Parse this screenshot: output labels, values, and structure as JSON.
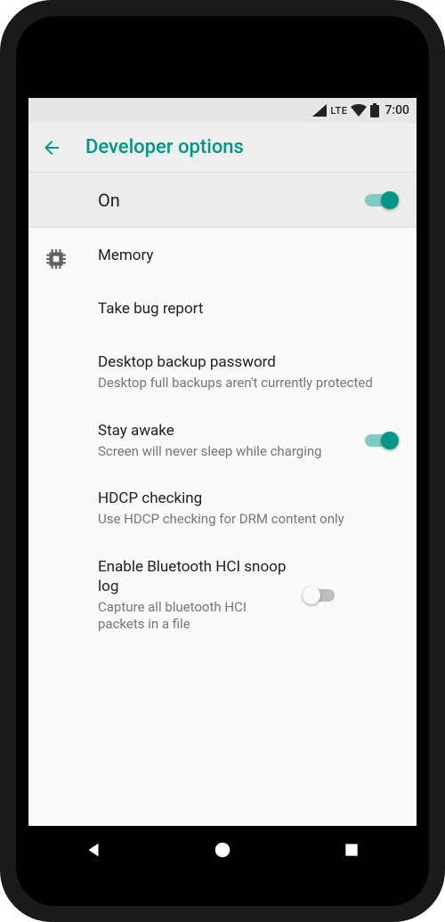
{
  "statusbar": {
    "network_label": "LTE",
    "time": "7:00"
  },
  "appbar": {
    "title": "Developer options"
  },
  "master": {
    "label": "On",
    "enabled": true
  },
  "items": [
    {
      "title": "Memory",
      "subtitle": null,
      "has_icon": true,
      "switch": null
    },
    {
      "title": "Take bug report",
      "subtitle": null,
      "has_icon": false,
      "switch": null
    },
    {
      "title": "Desktop backup password",
      "subtitle": "Desktop full backups aren't currently protected",
      "has_icon": false,
      "switch": null
    },
    {
      "title": "Stay awake",
      "subtitle": "Screen will never sleep while charging",
      "has_icon": false,
      "switch": true
    },
    {
      "title": "HDCP checking",
      "subtitle": "Use HDCP checking for DRM content only",
      "has_icon": false,
      "switch": null
    },
    {
      "title": "Enable Bluetooth HCI snoop log",
      "subtitle": "Capture all bluetooth HCI packets in a file",
      "has_icon": false,
      "switch": false
    }
  ],
  "colors": {
    "accent": "#009688",
    "accent_light": "#80cbc4"
  }
}
